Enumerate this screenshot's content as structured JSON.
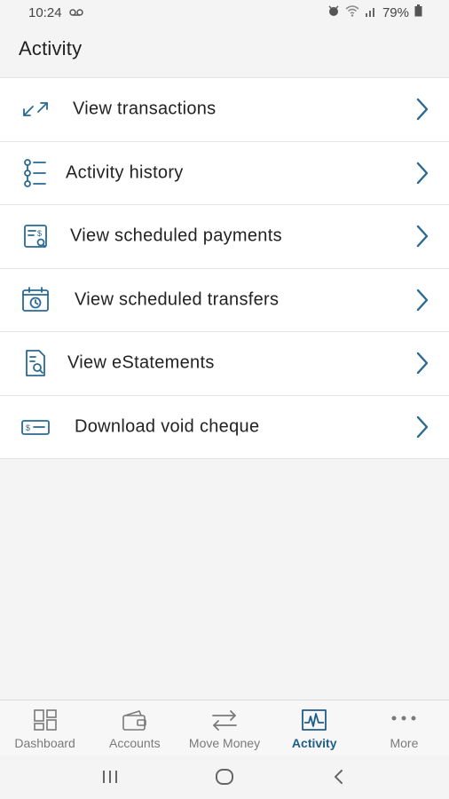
{
  "status_bar": {
    "time": "10:24",
    "battery": "79%"
  },
  "header": {
    "title": "Activity"
  },
  "menu": {
    "items": [
      {
        "label": "View transactions",
        "icon": "arrows-diagonal-icon"
      },
      {
        "label": "Activity history",
        "icon": "list-icon"
      },
      {
        "label": "View scheduled payments",
        "icon": "scheduled-payment-icon"
      },
      {
        "label": "View scheduled transfers",
        "icon": "calendar-clock-icon"
      },
      {
        "label": "View eStatements",
        "icon": "document-search-icon"
      },
      {
        "label": "Download void cheque",
        "icon": "cheque-icon"
      }
    ]
  },
  "bottom_nav": {
    "items": [
      {
        "label": "Dashboard",
        "icon": "dashboard-icon"
      },
      {
        "label": "Accounts",
        "icon": "wallet-icon"
      },
      {
        "label": "Move Money",
        "icon": "transfer-icon"
      },
      {
        "label": "Activity",
        "icon": "activity-icon",
        "active": true
      },
      {
        "label": "More",
        "icon": "more-icon"
      }
    ]
  },
  "colors": {
    "accent": "#1f5e8a",
    "icon_blue": "#2a6a94",
    "inactive": "#7a7a7a"
  }
}
